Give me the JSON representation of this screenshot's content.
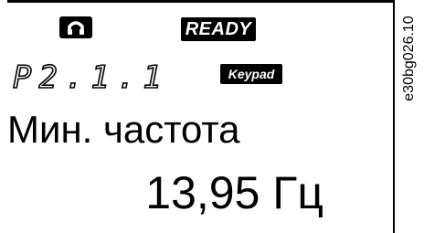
{
  "display": {
    "mode_icon": "keypad-mode-icon",
    "status": "READY",
    "parameter_code": "P2.1.1",
    "control_place": "Keypad",
    "parameter_name": "Мин. частота",
    "parameter_value": "13,95 Гц"
  },
  "figure_id": "e30bg026.10",
  "colors": {
    "background": "#ffffff",
    "foreground": "#000000"
  }
}
